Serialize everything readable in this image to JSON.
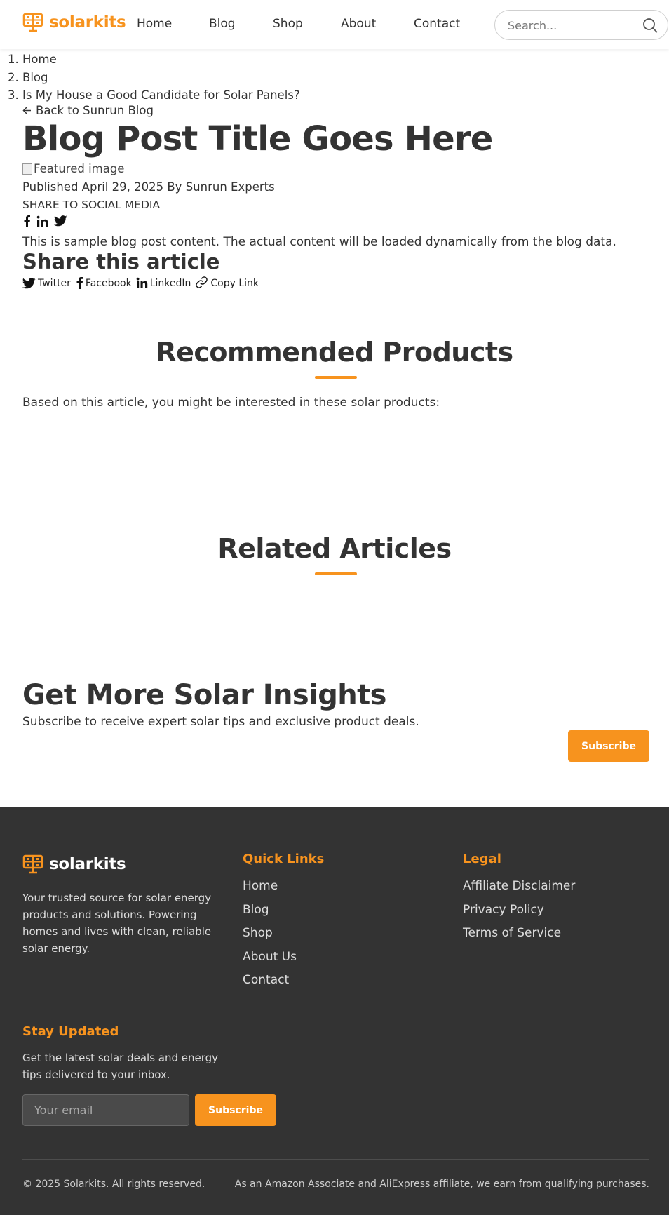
{
  "header": {
    "logo_text": "solarkits",
    "nav": [
      "Home",
      "Blog",
      "Shop",
      "About",
      "Contact"
    ],
    "search_placeholder": "Search..."
  },
  "breadcrumb": [
    "Home",
    "Blog",
    "Is My House a Good Candidate for Solar Panels?"
  ],
  "back_link": "Back to Sunrun Blog",
  "post": {
    "title": "Blog Post Title Goes Here",
    "featured_image_alt": "Featured image",
    "published": "Published April 29, 2025 By Sunrun Experts",
    "share_social_label": "SHARE TO SOCIAL MEDIA",
    "content": "This is sample blog post content. The actual content will be loaded dynamically from the blog data."
  },
  "share_article": {
    "title": "Share this article",
    "links": [
      "Twitter",
      "Facebook",
      "LinkedIn",
      "Copy Link"
    ]
  },
  "recommended": {
    "title": "Recommended Products",
    "description": "Based on this article, you might be interested in these solar products:"
  },
  "related": {
    "title": "Related Articles"
  },
  "insights": {
    "title": "Get More Solar Insights",
    "description": "Subscribe to receive expert solar tips and exclusive product deals.",
    "button": "Subscribe"
  },
  "footer": {
    "logo_text": "solarkits",
    "description": "Your trusted source for solar energy products and solutions. Powering homes and lives with clean, reliable solar energy.",
    "quick_links_title": "Quick Links",
    "quick_links": [
      "Home",
      "Blog",
      "Shop",
      "About Us",
      "Contact"
    ],
    "legal_title": "Legal",
    "legal_links": [
      "Affiliate Disclaimer",
      "Privacy Policy",
      "Terms of Service"
    ],
    "stay_updated_title": "Stay Updated",
    "stay_updated_desc": "Get the latest solar deals and energy tips delivered to your inbox.",
    "email_placeholder": "Your email",
    "subscribe_button": "Subscribe",
    "copyright": "© 2025 Solarkits. All rights reserved.",
    "affiliate_note": "As an Amazon Associate and AliExpress affiliate, we earn from qualifying purchases."
  },
  "colors": {
    "accent": "#f7931e",
    "footer_bg": "#333333",
    "text": "#333333"
  },
  "icons": [
    "solar-panel-logo-icon",
    "search-icon",
    "arrow-left-icon",
    "facebook-icon",
    "linkedin-icon",
    "twitter-icon",
    "link-icon"
  ]
}
